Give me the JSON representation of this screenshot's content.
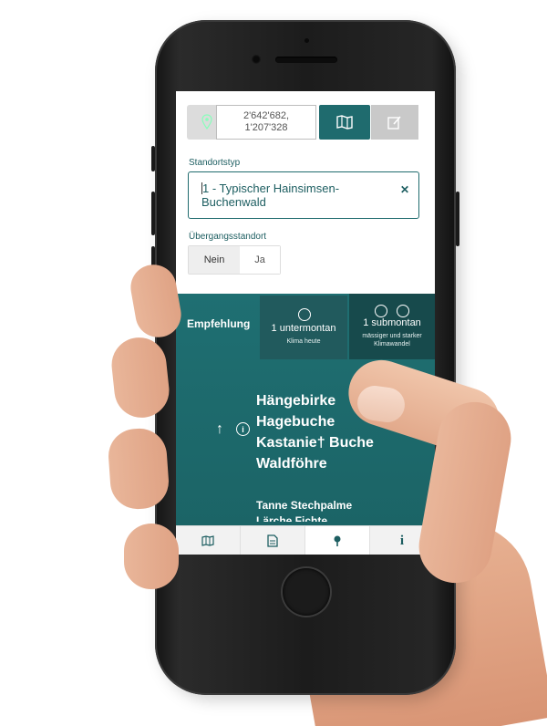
{
  "coordinates": {
    "line1": "2'642'682,",
    "line2": "1'207'328"
  },
  "standortstyp": {
    "label": "Standortstyp",
    "value": "1 - Typischer Hainsimsen-Buchenwald",
    "clear_icon": "close-icon"
  },
  "uebergang": {
    "label": "Übergangsstandort",
    "options": [
      "Nein",
      "Ja"
    ],
    "selected": "Nein"
  },
  "recommendation": {
    "title": "Empfehlung",
    "zone_current": {
      "number": "1",
      "name": "untermontan",
      "sub": "Klima heute"
    },
    "zone_future": {
      "number": "1",
      "name": "submontan",
      "sub": "mässiger und starker Klimawandel"
    },
    "trend_icon": "arrow-up-icon",
    "info_icon": "info-icon",
    "species_main": [
      "Hängebirke",
      "Hagebuche",
      "Kastanie† Buche",
      "Waldföhre"
    ],
    "species_other": "Tanne Stechpalme",
    "species_cut": "Lärche Fichte"
  },
  "bottom_nav": [
    "map-icon",
    "document-icon",
    "location-icon",
    "info-icon"
  ],
  "colors": {
    "primary": "#1f6b6e",
    "panel": "#1b6466",
    "text_primary": "#1d5e61"
  }
}
